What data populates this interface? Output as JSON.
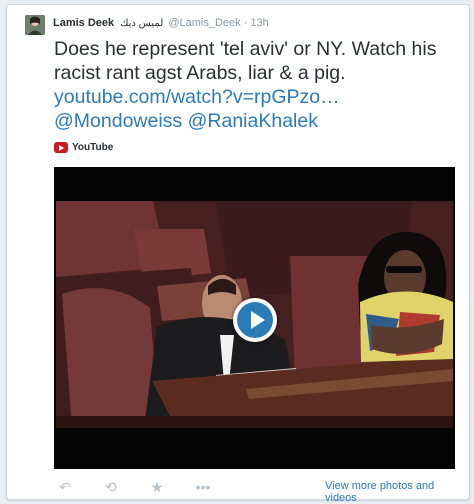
{
  "tweet": {
    "author_name": "Lamis Deek",
    "author_name_arabic": "لميس ديك",
    "handle": "@Lamis_Deek",
    "timestamp": "13h",
    "text": "Does he represent 'tel aviv' or NY. Watch his racist rant agst Arabs, liar & a pig.",
    "url_text": "youtube.com/watch?v=rpGPzo…",
    "mention_1": "@Mondoweiss",
    "mention_2": "@RaniaKhalek"
  },
  "card": {
    "source": "YouTube",
    "more_link": "View more photos and videos"
  },
  "actions": [
    {
      "icon": "reply-icon",
      "glyph": "↶"
    },
    {
      "icon": "retweet-icon",
      "glyph": "⟲"
    },
    {
      "icon": "favorite-icon",
      "glyph": "★"
    },
    {
      "icon": "more-icon",
      "glyph": "•••"
    }
  ],
  "colors": {
    "link": "#2b7bb9",
    "secondary_text": "#8899a6",
    "primary_text": "#292f33"
  }
}
